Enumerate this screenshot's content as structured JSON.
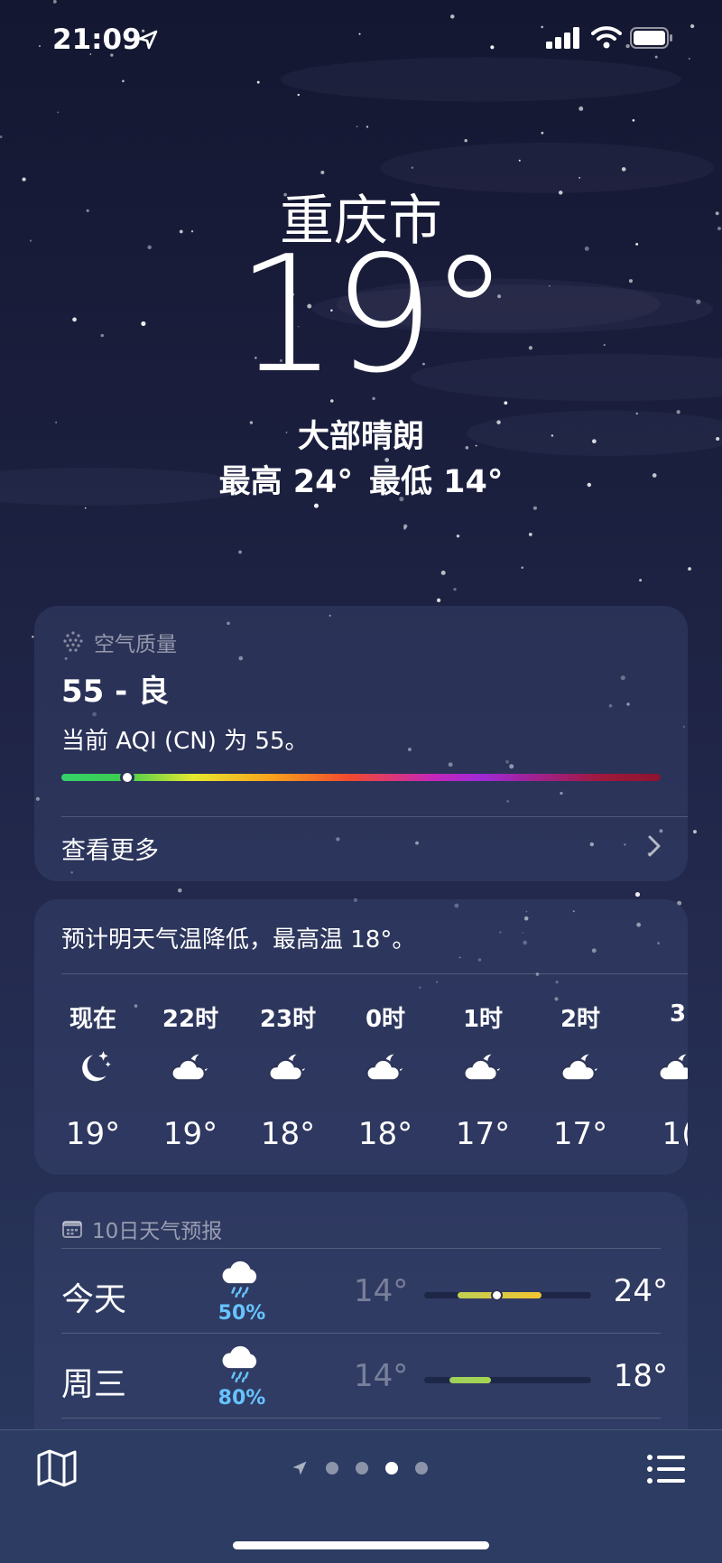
{
  "status_bar": {
    "time": "21:09"
  },
  "header": {
    "city": "重庆市",
    "temperature": "19°",
    "condition": "大部晴朗",
    "high": "最高 24°",
    "low": "最低 14°"
  },
  "air_quality": {
    "label": "空气质量",
    "value": "55 - 良",
    "description": "当前 AQI (CN) 为 55。",
    "level_fraction": 0.11,
    "see_more": "查看更多"
  },
  "hourly": {
    "summary": "预计明天气温降低，最高温 18°。",
    "items": [
      {
        "label": "现在",
        "icon": "moon-stars-icon",
        "temp": "19°"
      },
      {
        "label": "22时",
        "icon": "cloud-moon-icon",
        "temp": "19°"
      },
      {
        "label": "23时",
        "icon": "cloud-moon-icon",
        "temp": "18°"
      },
      {
        "label": "0时",
        "icon": "cloud-moon-icon",
        "temp": "18°"
      },
      {
        "label": "1时",
        "icon": "cloud-moon-icon",
        "temp": "17°"
      },
      {
        "label": "2时",
        "icon": "cloud-moon-icon",
        "temp": "17°"
      },
      {
        "label": "3",
        "icon": "cloud-moon-icon",
        "temp": "1("
      }
    ]
  },
  "daily": {
    "label": "10日天气预报",
    "days": [
      {
        "name": "今天",
        "icon": "cloud-rain-icon",
        "precip": "50%",
        "low": "14°",
        "high": "24°",
        "range_start": 0.2,
        "range_end": 0.7,
        "current": 0.43,
        "fill_colors": [
          "#bfcf52",
          "#f2c531"
        ]
      },
      {
        "name": "周三",
        "icon": "cloud-rain-icon",
        "precip": "80%",
        "low": "14°",
        "high": "18°",
        "range_start": 0.15,
        "range_end": 0.4,
        "current": null,
        "fill_colors": [
          "#9fd05a",
          "#a6d552"
        ]
      }
    ]
  },
  "toolbar": {
    "map_icon": "map-icon",
    "location_icon": "location-arrow-icon",
    "page_count": 4,
    "active_page": 3,
    "list_icon": "list-icon"
  }
}
